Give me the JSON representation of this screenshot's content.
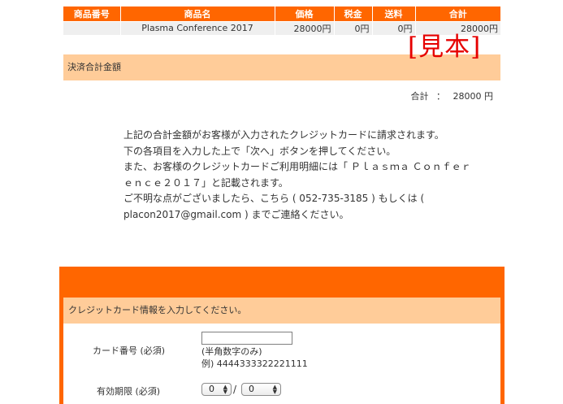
{
  "order_table": {
    "headers": [
      "商品番号",
      "商品名",
      "価格",
      "税金",
      "送料",
      "合計"
    ],
    "rows": [
      {
        "number": "",
        "name": "Plasma Conference 2017",
        "price": "28000円",
        "tax": "0円",
        "shipping": "0円",
        "total": "28000円"
      }
    ]
  },
  "sample_stamp": "[見本]",
  "payment_total": {
    "band_label": "決済合計金額",
    "total_label": "合計",
    "total_sep": "：",
    "total_value": "28000 円"
  },
  "notice": {
    "lines": [
      "上記の合計金額がお客様が入力されたクレジットカードに請求されます。",
      "下の各項目を入力した上で「次へ」ボタンを押してください。",
      "また、お客様のクレジットカードご利用明細には「 Ｐｌａｓｍａ Ｃｏｎｆｅｒ",
      "ｅｎｃｅ２０１７」と記載されます。",
      "ご不明な点がございましたら、こちら ( 052-735-3185 ) もしくは (",
      "placon2017@gmail.com ) までご連絡ください。"
    ]
  },
  "card_form": {
    "heading": "クレジットカード情報を入力してください。",
    "card_number": {
      "label": "カード番号 (必須)",
      "value": "",
      "hint": "(半角数字のみ)",
      "example": "例) 4444333322221111"
    },
    "expiry": {
      "label": "有効期限 (必須)",
      "month_selected": "0",
      "separator": "/",
      "year_selected": "0"
    }
  },
  "colors": {
    "header_orange": "#ff6600",
    "band_peach": "#ffcc99",
    "stamp_red": "#e60000",
    "row_gray": "#efefef"
  }
}
